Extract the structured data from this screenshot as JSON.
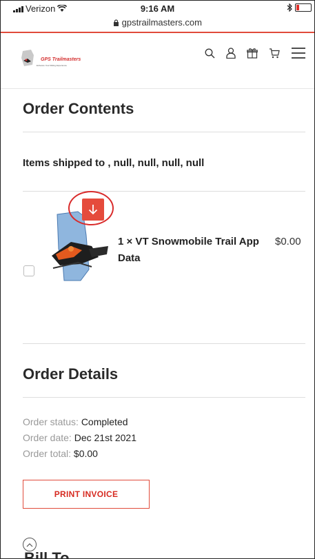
{
  "status_bar": {
    "carrier": "Verizon",
    "time": "9:16 AM"
  },
  "browser": {
    "url": "gpstrailmasters.com"
  },
  "header": {
    "logo_text": "GPS Trailmasters",
    "logo_tagline": "Enhance Your Riding Experience",
    "icons": [
      "search-icon",
      "user-icon",
      "gift-icon",
      "cart-icon",
      "menu-icon"
    ]
  },
  "order_contents": {
    "title": "Order Contents",
    "shipping_text": "Items shipped to , null, null, null, null",
    "item": {
      "name": "1 × VT Snowmobile Trail App Data",
      "price": "$0.00",
      "download_icon": "arrow-down-icon"
    }
  },
  "order_details": {
    "title": "Order Details",
    "status_label": "Order status:",
    "status_value": "Completed",
    "date_label": "Order date:",
    "date_value": "Dec 21st 2021",
    "total_label": "Order total:",
    "total_value": "$0.00",
    "print_button": "PRINT INVOICE"
  },
  "bill_to": {
    "title": "Bill To"
  },
  "colors": {
    "accent": "#e04a3a",
    "annotation": "#d92b2b"
  }
}
